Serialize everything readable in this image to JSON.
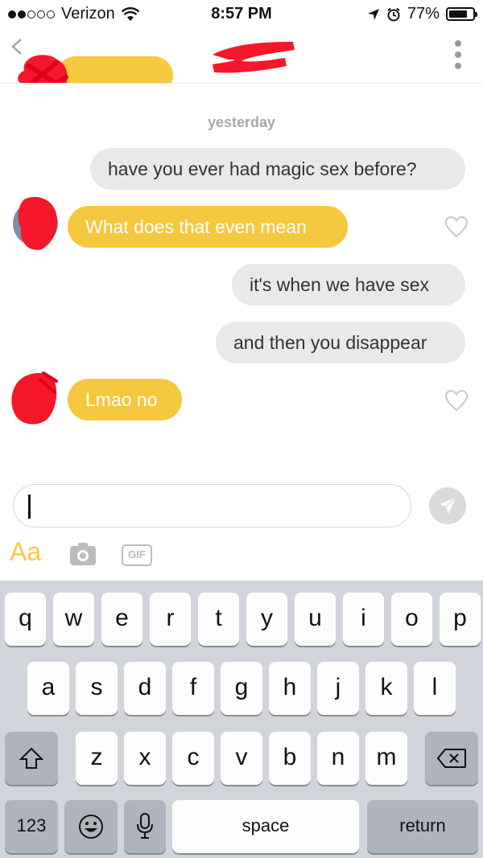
{
  "status_bar": {
    "carrier": "Verizon",
    "time": "8:57 PM",
    "battery_pct": "77%",
    "battery_fraction": 0.77,
    "icons": [
      "signal-icon",
      "wifi-icon",
      "location-icon",
      "alarm-icon",
      "battery-icon"
    ]
  },
  "header": {
    "icons": [
      "back-chevron-icon",
      "redacted-avatar",
      "redacted-name",
      "more-menu-icon"
    ]
  },
  "chat": {
    "timestamp": "yesterday",
    "messages": [
      {
        "side": "out",
        "text": "have you ever had magic sex before?"
      },
      {
        "side": "in",
        "text": "What does that even mean"
      },
      {
        "side": "out",
        "text": "it's when we have sex"
      },
      {
        "side": "out",
        "text": "and then you disappear"
      },
      {
        "side": "in",
        "text": "Lmao no"
      }
    ]
  },
  "composer": {
    "value": "",
    "format_label": "Aa",
    "gif_label": "GIF",
    "icons": [
      "camera-icon",
      "send-icon"
    ]
  },
  "keyboard": {
    "row1": [
      "q",
      "w",
      "e",
      "r",
      "t",
      "y",
      "u",
      "i",
      "o",
      "p"
    ],
    "row2": [
      "a",
      "s",
      "d",
      "f",
      "g",
      "h",
      "j",
      "k",
      "l"
    ],
    "row3": [
      "z",
      "x",
      "c",
      "v",
      "b",
      "n",
      "m"
    ],
    "numbers_label": "123",
    "space_label": "space",
    "return_label": "return",
    "icons": [
      "shift-icon",
      "backspace-icon",
      "emoji-icon",
      "microphone-icon"
    ]
  },
  "colors": {
    "incoming_bubble": "#f6c83f",
    "outgoing_bubble": "#e9e9ea",
    "accent": "#f7c940",
    "keyboard_bg": "#d1d5db"
  }
}
